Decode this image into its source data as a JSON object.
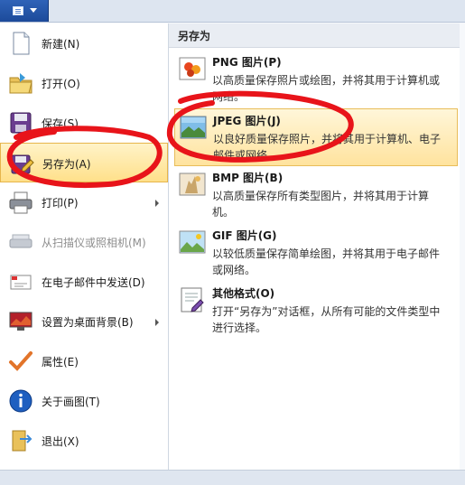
{
  "left_menu": [
    {
      "label": "新建(N)",
      "icon": "new-doc-icon",
      "submenu": false
    },
    {
      "label": "打开(O)",
      "icon": "open-folder-icon",
      "submenu": false
    },
    {
      "label": "保存(S)",
      "icon": "save-disk-icon",
      "submenu": false
    },
    {
      "label": "另存为(A)",
      "icon": "save-as-icon",
      "submenu": true
    },
    {
      "label": "打印(P)",
      "icon": "printer-icon",
      "submenu": true
    },
    {
      "label": "从扫描仪或照相机(M)",
      "icon": "scanner-icon",
      "submenu": false
    },
    {
      "label": "在电子邮件中发送(D)",
      "icon": "email-icon",
      "submenu": false
    },
    {
      "label": "设置为桌面背景(B)",
      "icon": "desktop-background-icon",
      "submenu": true
    },
    {
      "label": "属性(E)",
      "icon": "checkmark-icon",
      "submenu": false
    },
    {
      "label": "关于画图(T)",
      "icon": "info-icon",
      "submenu": false
    },
    {
      "label": "退出(X)",
      "icon": "exit-icon",
      "submenu": false
    }
  ],
  "save_as": {
    "header": "另存为",
    "formats": [
      {
        "title": "PNG 图片(P)",
        "desc": "以高质量保存照片或绘图，并将其用于计算机或网络。",
        "icon": "png-image-icon"
      },
      {
        "title": "JPEG 图片(J)",
        "desc": "以良好质量保存照片，并将其用于计算机、电子邮件或网络。",
        "icon": "jpeg-image-icon"
      },
      {
        "title": "BMP 图片(B)",
        "desc": "以高质量保存所有类型图片，并将其用于计算机。",
        "icon": "bmp-image-icon"
      },
      {
        "title": "GIF 图片(G)",
        "desc": "以较低质量保存简单绘图，并将其用于电子邮件或网络。",
        "icon": "gif-image-icon"
      },
      {
        "title": "其他格式(O)",
        "desc": "打开“另存为”对话框，从所有可能的文件类型中进行选择。",
        "icon": "other-formats-icon"
      }
    ]
  },
  "colors": {
    "highlight": "#ffe08a",
    "annotation": "#e8141a",
    "app_button": "#2f63b8"
  }
}
